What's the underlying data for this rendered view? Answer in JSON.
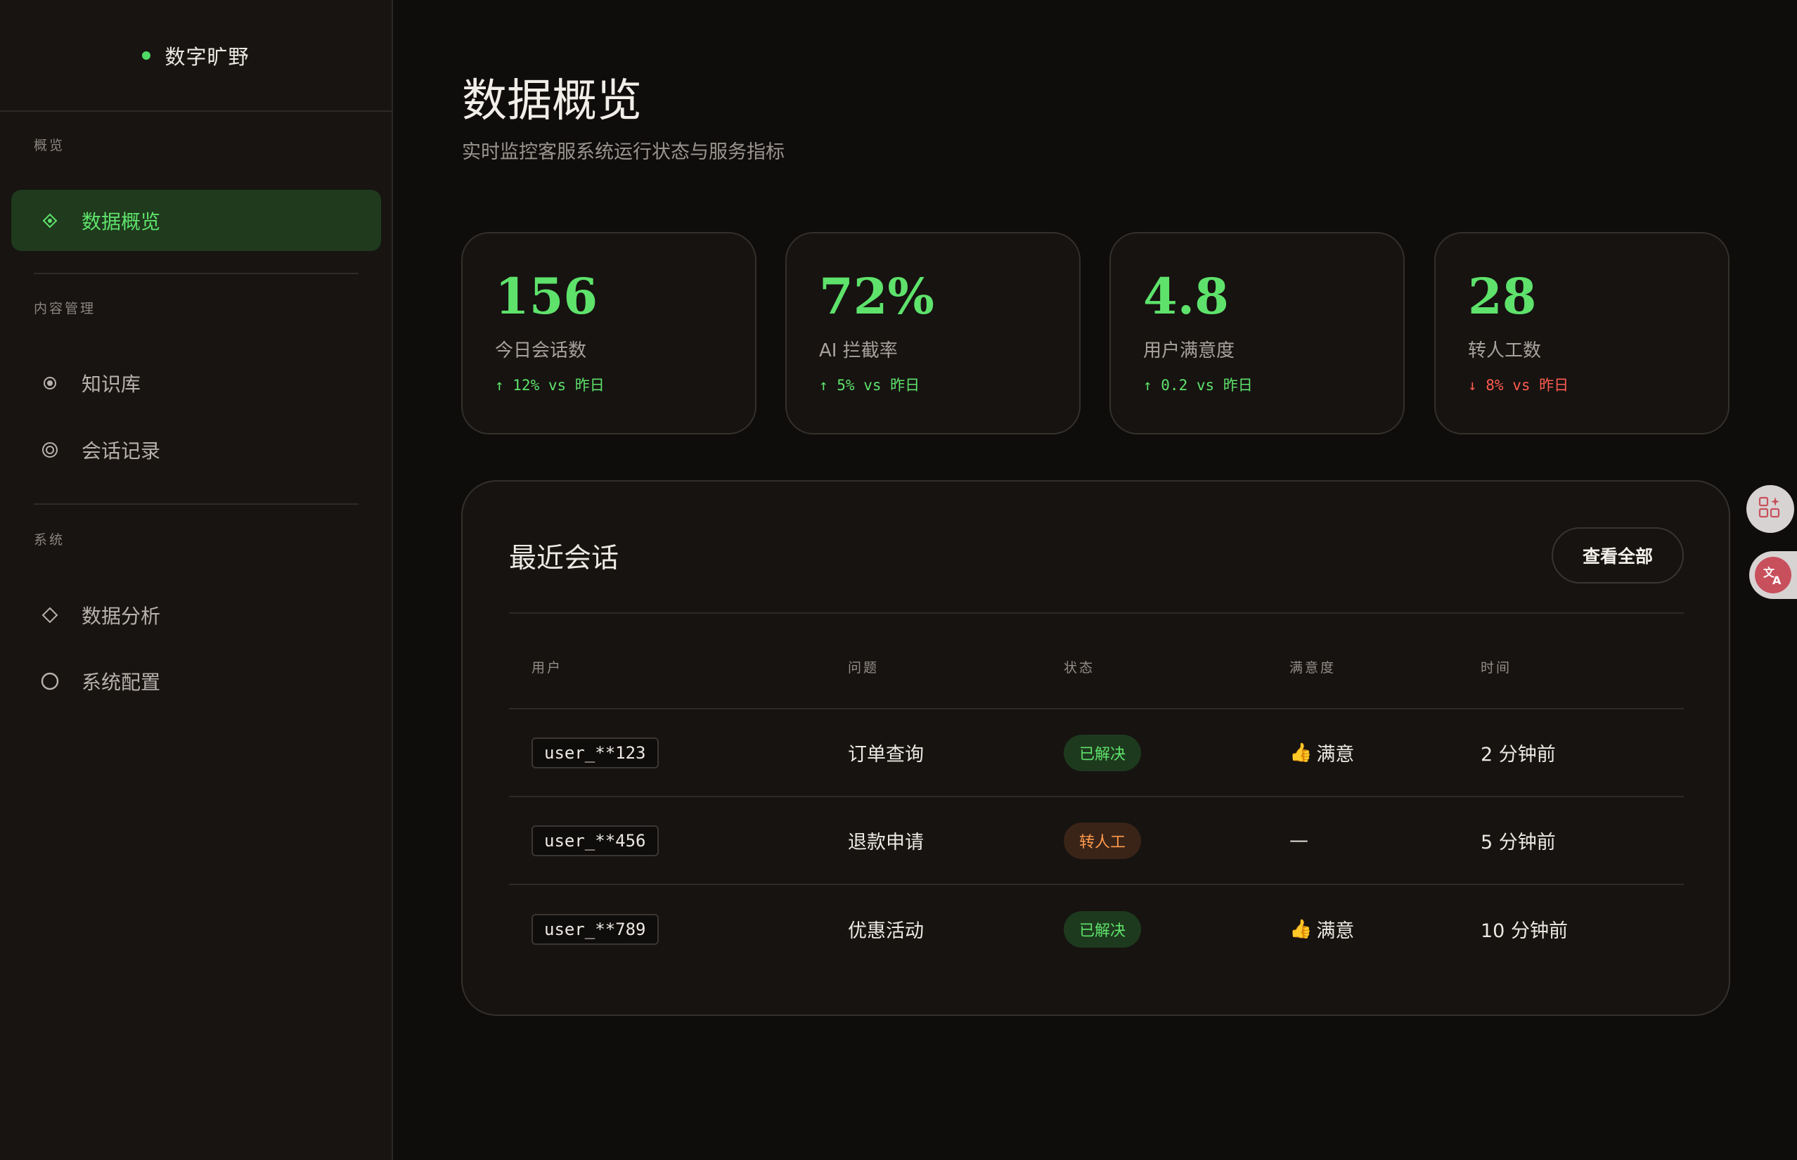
{
  "brand": {
    "name": "数字旷野"
  },
  "sidebar": {
    "sections": [
      {
        "label": "概览"
      },
      {
        "label": "内容管理"
      },
      {
        "label": "系统"
      }
    ],
    "items": [
      {
        "label": "数据概览",
        "icon": "diamond-dot-icon",
        "active": true
      },
      {
        "label": "知识库",
        "icon": "radio-dot-icon",
        "active": false
      },
      {
        "label": "会话记录",
        "icon": "double-circle-icon",
        "active": false
      },
      {
        "label": "数据分析",
        "icon": "diamond-outline-icon",
        "active": false
      },
      {
        "label": "系统配置",
        "icon": "circle-outline-icon",
        "active": false
      }
    ]
  },
  "header": {
    "title": "数据概览",
    "subtitle": "实时监控客服系统运行状态与服务指标"
  },
  "stats": [
    {
      "value": "156",
      "label": "今日会话数",
      "trend": "↑ 12% vs 昨日",
      "direction": "up"
    },
    {
      "value": "72%",
      "label": "AI 拦截率",
      "trend": "↑ 5% vs 昨日",
      "direction": "up"
    },
    {
      "value": "4.8",
      "label": "用户满意度",
      "trend": "↑ 0.2 vs 昨日",
      "direction": "up"
    },
    {
      "value": "28",
      "label": "转人工数",
      "trend": "↓ 8% vs 昨日",
      "direction": "down"
    }
  ],
  "recent": {
    "title": "最近会话",
    "view_all_label": "查看全部",
    "columns": [
      "用户",
      "问题",
      "状态",
      "满意度",
      "时间"
    ],
    "rows": [
      {
        "user": "user_**123",
        "question": "订单查询",
        "status": "已解决",
        "status_type": "resolved",
        "satisfaction": "满意",
        "has_thumb": true,
        "time": "2 分钟前"
      },
      {
        "user": "user_**456",
        "question": "退款申请",
        "status": "转人工",
        "status_type": "transfer",
        "satisfaction": "—",
        "has_thumb": false,
        "time": "5 分钟前"
      },
      {
        "user": "user_**789",
        "question": "优惠活动",
        "status": "已解决",
        "status_type": "resolved",
        "satisfaction": "满意",
        "has_thumb": true,
        "time": "10 分钟前"
      }
    ]
  },
  "colors": {
    "accent": "#5ee26b",
    "down": "#ff5b4f",
    "transfer": "#ff9a4c",
    "background": "#0f0d0c"
  }
}
